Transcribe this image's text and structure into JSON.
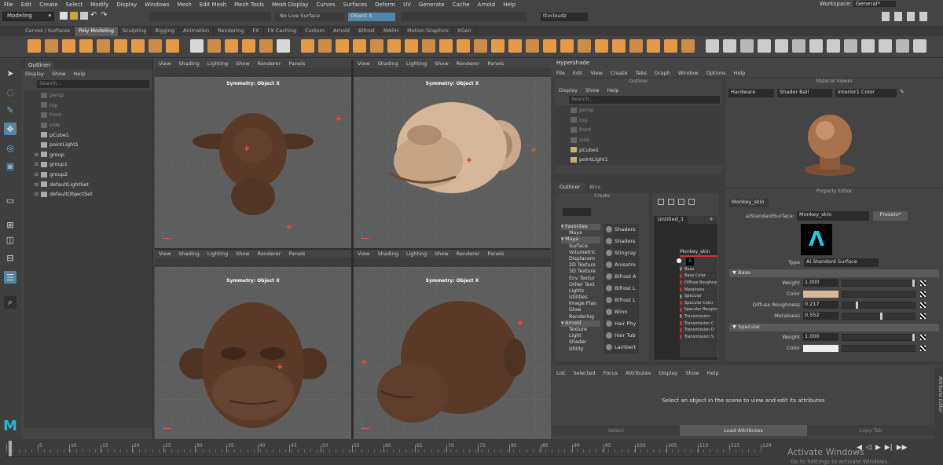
{
  "menubar": {
    "items": [
      "File",
      "Edit",
      "Create",
      "Select",
      "Modify",
      "Display",
      "Windows",
      "Mesh",
      "Edit Mesh",
      "Mesh Tools",
      "Mesh Display",
      "Curves",
      "Surfaces",
      "Deform",
      "UV",
      "Generate",
      "Cache",
      "Arnold",
      "Help"
    ],
    "workspace_label": "Workspace:",
    "workspace_value": "General*"
  },
  "statusline": {
    "mode": "Modeling",
    "live_surface": "No Live Surface",
    "symmetry": "Object X",
    "user": "ttvcloudz"
  },
  "shelf_tabs": [
    "Curves / Surfaces",
    "Poly Modeling",
    "Sculpting",
    "Rigging",
    "Animation",
    "Rendering",
    "FX",
    "FX Caching",
    "Custom",
    "Arnold",
    "Bifrost",
    "MASH",
    "Motion Graphics",
    "XGen"
  ],
  "shelf_active": "Poly Modeling",
  "outliner": {
    "title": "Outliner",
    "menus": [
      "Display",
      "Show",
      "Help"
    ],
    "search_placeholder": "Search...",
    "items": [
      {
        "label": "persp",
        "dim": true
      },
      {
        "label": "top",
        "dim": true
      },
      {
        "label": "front",
        "dim": true
      },
      {
        "label": "side",
        "dim": true
      },
      {
        "label": "pCube1",
        "dim": false
      },
      {
        "label": "pointLight1",
        "dim": false
      },
      {
        "label": "group",
        "dim": false
      },
      {
        "label": "group1",
        "dim": false
      },
      {
        "label": "group2",
        "dim": false
      },
      {
        "label": "defaultLightSet",
        "dim": false
      },
      {
        "label": "defaultObjectSet",
        "dim": false
      }
    ]
  },
  "viewport_menus": [
    "View",
    "Shading",
    "Lighting",
    "Show",
    "Renderer",
    "Panels"
  ],
  "symmetry_label": "Symmetry: Object X",
  "hypershade": {
    "title": "Hypershade",
    "menus": [
      "File",
      "Edit",
      "View",
      "Create",
      "Tabs",
      "Graph",
      "Window",
      "Options",
      "Help"
    ],
    "outliner_title": "Outliner",
    "outliner_menus": [
      "Display",
      "Show",
      "Help"
    ],
    "search_placeholder": "Search...",
    "outliner_items": [
      {
        "label": "persp",
        "dim": true
      },
      {
        "label": "top",
        "dim": true
      },
      {
        "label": "front",
        "dim": true
      },
      {
        "label": "side",
        "dim": true
      },
      {
        "label": "pCube1",
        "dim": false
      },
      {
        "label": "pointLight1",
        "dim": false
      }
    ],
    "bottom_tabs": [
      "Outliner",
      "Bins"
    ],
    "create_title": "Create",
    "create_tree": [
      {
        "label": "Favorites",
        "head": true
      },
      {
        "label": "Maya",
        "head": false
      },
      {
        "label": "Maya",
        "head": true
      },
      {
        "label": "Surface",
        "head": false
      },
      {
        "label": "Volumetric",
        "head": false
      },
      {
        "label": "Displacem",
        "head": false
      },
      {
        "label": "2D Texture",
        "head": false
      },
      {
        "label": "3D Texture",
        "head": false
      },
      {
        "label": "Env Textur",
        "head": false
      },
      {
        "label": "Other Text",
        "head": false
      },
      {
        "label": "Lights",
        "head": false
      },
      {
        "label": "Utilities",
        "head": false
      },
      {
        "label": "Image Plan",
        "head": false
      },
      {
        "label": "Glow",
        "head": false
      },
      {
        "label": "Rendering",
        "head": false
      },
      {
        "label": "Arnold",
        "head": true
      },
      {
        "label": "Texture",
        "head": false
      },
      {
        "label": "Light",
        "head": false
      },
      {
        "label": "Shader",
        "head": false
      },
      {
        "label": "Utility",
        "head": false
      }
    ],
    "shader_list": [
      "Shaders",
      "Shaders",
      "Stingray",
      "Anisotro",
      "Bifrost A",
      "Bifrost L",
      "Bifrost L",
      "Blinn",
      "Hair Phy",
      "Hair Tub",
      "Lambert"
    ],
    "graph_tab": "Untitled_1",
    "node": {
      "title": "Monkey_skin",
      "ports": [
        "Base",
        "Base Color",
        "Diffuse Roughne",
        "Metalness",
        "Specular",
        "Specular Color",
        "Specular Roughn",
        "Transmission",
        "Transmission C",
        "Transmission D",
        "Transmission S"
      ]
    },
    "material_viewer": {
      "title": "Material Viewer",
      "renderer": "Hardware",
      "shape": "Shader Ball",
      "env": "Interior1 Color"
    },
    "property_editor": {
      "title": "Property Editor",
      "tab": "Monkey_skin",
      "type_label": "aiStandardSurface:",
      "name_value": "Monkey_skin",
      "presets": "Presets*",
      "type_field_label": "Type",
      "type_value": "Ai Standard Surface",
      "sections": [
        {
          "label": "Base"
        },
        {
          "label": "Specular"
        }
      ],
      "base_attrs": [
        {
          "label": "Weight",
          "value": "1.000",
          "fill": 1.0
        },
        {
          "label": "Color",
          "value": "",
          "fill": 0
        },
        {
          "label": "Diffuse Roughness",
          "value": "0.217",
          "fill": 0.217
        },
        {
          "label": "Metalness",
          "value": "0.552",
          "fill": 0.552
        }
      ],
      "spec_attrs": [
        {
          "label": "Weight",
          "value": "1.000",
          "fill": 1.0
        },
        {
          "label": "Color",
          "value": "",
          "fill": 0
        }
      ]
    }
  },
  "attribute_editor": {
    "menus": [
      "List",
      "Selected",
      "Focus",
      "Attributes",
      "Display",
      "Show",
      "Help"
    ],
    "message": "Select an object in the scene to view and edit its attributes",
    "buttons": [
      "Select",
      "Load Attributes",
      "Copy Tab"
    ],
    "side_label": "Attribute Editor"
  },
  "timeline": {
    "ticks": [
      "1",
      "5",
      "10",
      "15",
      "20",
      "25",
      "30",
      "35",
      "40",
      "45",
      "50",
      "55",
      "60",
      "65",
      "70",
      "75",
      "80",
      "85",
      "90",
      "95",
      "100",
      "105",
      "110",
      "115",
      "120"
    ],
    "current_frame": "1",
    "watermark": "Activate Windows",
    "watermark_sub": "Go to Settings to activate Windows."
  },
  "colors": {
    "accent": "#5285a6",
    "orange": "#e59a48",
    "monkey": "#5a3a27",
    "skin_light": "#d6b79a"
  }
}
